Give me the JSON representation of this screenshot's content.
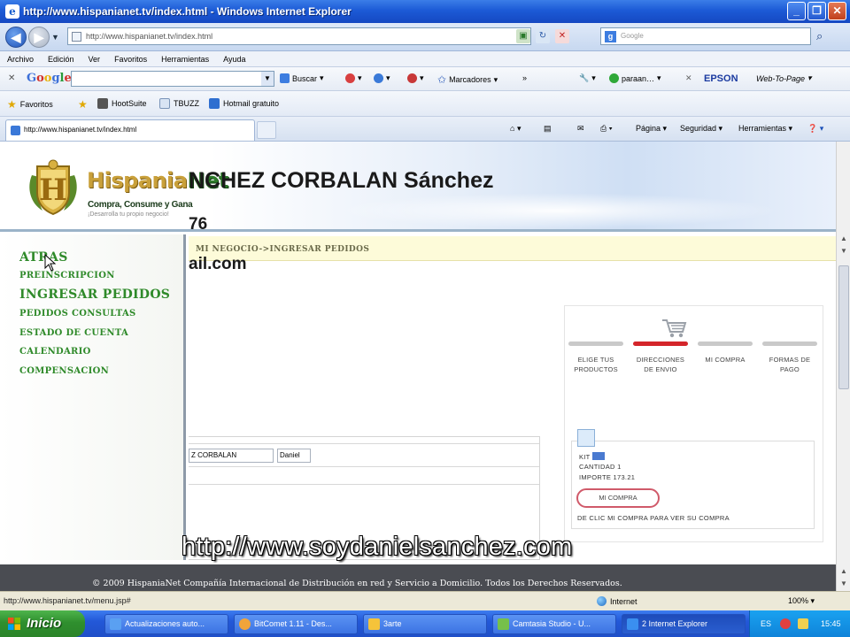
{
  "window": {
    "title": "http://www.hispanianet.tv/index.html - Windows Internet Explorer",
    "address": "http://www.hispanianet.tv/index.html",
    "search_placeholder": "Google"
  },
  "menu": [
    "Archivo",
    "Edición",
    "Ver",
    "Favoritos",
    "Herramientas",
    "Ayuda"
  ],
  "google_toolbar": {
    "buscar": "Buscar",
    "marcadores": "Marcadores",
    "more": "»",
    "paraan": "paraan…",
    "epson": "EPSON",
    "web_to_page": "Web-To-Page"
  },
  "favorites_bar": {
    "favoritos": "Favoritos",
    "items": [
      "HootSuite",
      "TBUZZ",
      "Hotmail gratuito"
    ]
  },
  "tab": {
    "title": "http://www.hispanianet.tv/index.html",
    "commands": [
      "Página",
      "Seguridad",
      "Herramientas"
    ]
  },
  "site": {
    "logo_hispania": "Hispania",
    "logo_net": "Net",
    "tagline": "Compra, Consume y Gana",
    "subtagline": "¡Desarrolla tu propio negocio!",
    "crumb": "MI NEGOCIO->INGRESAR PEDIDOS",
    "sidebar": [
      {
        "label": "ATRAS",
        "size": "big"
      },
      {
        "label": "PREINSCRIPCION",
        "size": "sm"
      },
      {
        "label": "INGRESAR PEDIDOS",
        "size": "big"
      },
      {
        "label": "PEDIDOS CONSULTAS",
        "size": "sm"
      },
      {
        "label": "ESTADO DE CUENTA",
        "size": "sm"
      },
      {
        "label": "CALENDARIO",
        "size": "sm"
      },
      {
        "label": "COMPENSACION",
        "size": "sm"
      }
    ],
    "customer_name": "NCHEZ CORBALAN Sánchez",
    "customer_id": "76",
    "customer_email": "ail.com",
    "form_lastname": "Z CORBALAN",
    "form_firstname": "Daniel",
    "steps": [
      {
        "label": "ELIGE TUS PRODUCTOS",
        "active": false
      },
      {
        "label": "DIRECCIONES DE ENVIO",
        "active": true
      },
      {
        "label": "MI COMPRA",
        "active": false
      },
      {
        "label": "FORMAS DE PAGO",
        "active": false
      }
    ],
    "cart": {
      "kit": "KIT",
      "cantidad": "CANTIDAD 1",
      "importe": "IMPORTE 173.21",
      "button": "MI COMPRA",
      "hint": "DE CLIC MI COMPRA PARA VER SU COMPRA"
    },
    "footer": "© 2009 HispaniaNet Compañía Internacional de Distribución en red y Servicio a Domicilio. Todos los Derechos Reservados.",
    "watermark": "http://www.soydanielsanchez.com"
  },
  "status": {
    "url": "http://www.hispanianet.tv/menu.jsp#",
    "zone": "Internet",
    "zoom": "100%"
  },
  "taskbar": {
    "start": "Inicio",
    "buttons": [
      {
        "label": "Actualizaciones auto...",
        "color": "#5aa0f2"
      },
      {
        "label": "BitComet 1.11 - Des...",
        "color": "#f1a43a"
      },
      {
        "label": "3arte",
        "color": "#f5c33a"
      },
      {
        "label": "Camtasia Studio - U...",
        "color": "#76c04a"
      },
      {
        "label": "2 Internet Explorer",
        "color": "#3a8ff0"
      }
    ],
    "lang": "ES",
    "clock": "15:45"
  },
  "colors": {
    "accent_green": "#2f8a2a",
    "step_active": "#d4252a",
    "footer_bg": "#4a4c52"
  }
}
